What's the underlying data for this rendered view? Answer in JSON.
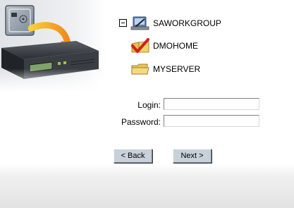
{
  "icons": {
    "art": "server-migration-illustration",
    "workgroup": "network-workgroup-icon",
    "domain": "domain-checked-icon",
    "server": "folder-icon"
  },
  "tree": {
    "root": {
      "label": "SAWORKGROUP",
      "expanded": true
    },
    "children": [
      {
        "label": "DMOHOME"
      },
      {
        "label": "MYSERVER"
      }
    ]
  },
  "form": {
    "login_label": "Login:",
    "login_value": "",
    "password_label": "Password:",
    "password_value": ""
  },
  "buttons": {
    "back": "< Back",
    "next": "Next >"
  }
}
